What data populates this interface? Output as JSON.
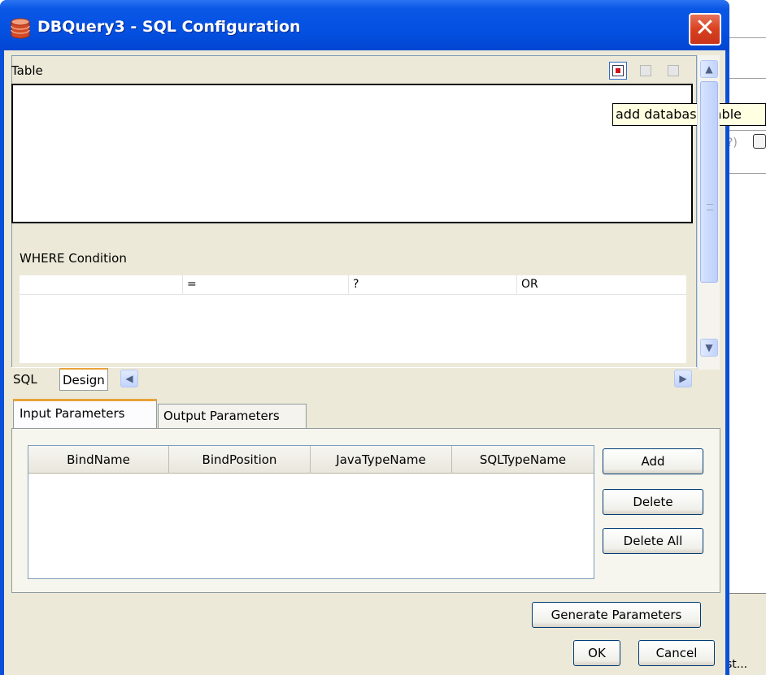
{
  "window": {
    "title": "DBQuery3 - SQL Configuration",
    "close_label": "✕"
  },
  "background": {
    "control_fragment": "?)",
    "bottom_text": "st..."
  },
  "editor": {
    "table_label": "Table",
    "toolbar": {
      "add_table_icon": "add-table-icon",
      "tooltip": "add database table"
    },
    "where_label": "WHERE Condition",
    "where_row": {
      "column": "",
      "operator": "=",
      "value": "?",
      "conjunction": "OR"
    },
    "tabs": [
      "SQL",
      "Design"
    ]
  },
  "params": {
    "tabs": [
      "Input Parameters",
      "Output Parameters"
    ],
    "columns": [
      "BindName",
      "BindPosition",
      "JavaTypeName",
      "SQLTypeName"
    ],
    "rows": [],
    "buttons": {
      "add": "Add",
      "delete": "Delete",
      "delete_all": "Delete All"
    }
  },
  "footer": {
    "generate": "Generate Parameters",
    "ok": "OK",
    "cancel": "Cancel"
  },
  "colors": {
    "title_bar": "#0451e2",
    "dialog_bg": "#ece9d8",
    "active_tab_accent": "#e8a33a",
    "close_button": "#d8411f"
  }
}
